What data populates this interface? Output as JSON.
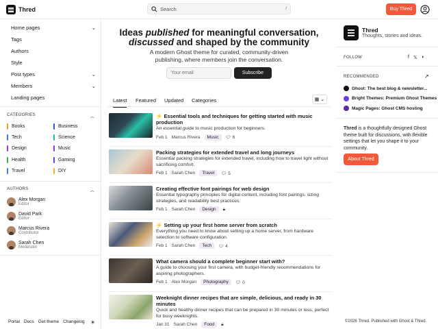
{
  "header": {
    "logo_text": "Thred",
    "search_placeholder": "Search",
    "search_shortcut": "/",
    "buy_label": "Buy Thred"
  },
  "sidebar": {
    "nav": [
      {
        "label": "Home pages",
        "expand": true
      },
      {
        "label": "Tags",
        "expand": false
      },
      {
        "label": "Authors",
        "expand": false
      },
      {
        "label": "Style",
        "expand": false
      },
      {
        "label": "Post types",
        "expand": true
      },
      {
        "label": "Members",
        "expand": true
      },
      {
        "label": "Landing pages",
        "expand": false
      }
    ],
    "categories_title": "CATEGORIES",
    "categories": [
      {
        "label": "Books",
        "color": "#f29b2b"
      },
      {
        "label": "Business",
        "color": "#3d4fd1"
      },
      {
        "label": "Tech",
        "color": "#3c7be0"
      },
      {
        "label": "Science",
        "color": "#27b3a5"
      },
      {
        "label": "Design",
        "color": "#9b3fd9"
      },
      {
        "label": "Music",
        "color": "#8a3fe0"
      },
      {
        "label": "Health",
        "color": "#2fb34a"
      },
      {
        "label": "Gaming",
        "color": "#6b3fe0"
      },
      {
        "label": "Travel",
        "color": "#3e7fe6"
      },
      {
        "label": "DIY",
        "color": "#e8b52b"
      }
    ],
    "authors_title": "AUTHORS",
    "authors": [
      {
        "name": "Alex Morgan",
        "role": "Editor"
      },
      {
        "name": "David Park",
        "role": "Editor"
      },
      {
        "name": "Marcus Rivera",
        "role": "Contributor"
      },
      {
        "name": "Sarah Chen",
        "role": "Moderator"
      }
    ],
    "footer_links": [
      "Portal",
      "Docs",
      "Get theme",
      "Changelog"
    ]
  },
  "hero": {
    "title_1": "Ideas ",
    "title_em1": "published",
    "title_2": " for meaningful conversation,",
    "title_em2": "discussed",
    "title_3": " and shaped by the community",
    "subtitle": "A modern Ghost theme for curated, community-driven publishing, where members join the conversation.",
    "email_placeholder": "Your email",
    "subscribe_label": "Subscribe"
  },
  "tabs": [
    "Latest",
    "Featured",
    "Updated",
    "Categories"
  ],
  "posts": [
    {
      "title": "Essential tools and techniques for getting started with music production",
      "featured": true,
      "excerpt": "An essential guide to music production for beginners.",
      "date": "Feb 1",
      "author": "Marcus Rivera",
      "tag": "Music",
      "comments": "6",
      "locked": false
    },
    {
      "title": "Packing strategies for extended travel and long journeys",
      "featured": false,
      "excerpt": "Essential packing strategies for extended travel, including how to travel light without sacrificing comfort.",
      "date": "Feb 1",
      "author": "Sarah Chen",
      "tag": "Travel",
      "comments": "5",
      "locked": false
    },
    {
      "title": "Creating effective font pairings for web design",
      "featured": false,
      "excerpt": "Essential typography principles for digital content, including font pairings, sizing strategies, and readability best practices.",
      "date": "Feb 1",
      "author": "Sarah Chen",
      "tag": "Design",
      "comments": "",
      "locked": true
    },
    {
      "title": "Setting up your first home server from scratch",
      "featured": true,
      "excerpt": "Everything you need to know about setting up a home server, from hardware selection to software configuration.",
      "date": "Feb 1",
      "author": "Sarah Chen",
      "tag": "Tech",
      "comments": "4",
      "locked": false
    },
    {
      "title": "What camera should a complete beginner start with?",
      "featured": false,
      "excerpt": "A guide to choosing your first camera, with budget-friendly recommendations for aspiring photographers.",
      "date": "Feb 1",
      "author": "Alex Morgan",
      "tag": "Photography",
      "comments": "0",
      "locked": false
    },
    {
      "title": "Weeknight dinner recipes that are simple, delicious, and ready in 30 minutes",
      "featured": false,
      "excerpt": "Quick and healthy dinner recipes that can be prepared in 30 minutes or less, perfect for busy weeknights.",
      "date": "Jan 31",
      "author": "Sarah Chen",
      "tag": "Food",
      "comments": "",
      "locked": true
    }
  ],
  "right": {
    "title": "Thred",
    "subtitle": "Thoughts, stories and ideas.",
    "follow_label": "FOLLOW",
    "recommended_label": "RECOMMENDED",
    "recommended": [
      {
        "label": "Ghost: The best blog & newsletter...",
        "color": "#111"
      },
      {
        "label": "Bright Themes: Premium Ghost Themes",
        "color": "#6b3fe0"
      },
      {
        "label": "Magic Pages: Ghost CMS hosting",
        "color": "#5a2ea6"
      }
    ],
    "about_name": "Thred",
    "about_text": " is a thoughtfully designed Ghost theme built for discussions, with flexible settings that let you shape it to your community.",
    "about_button": "About Thred",
    "copyright": "©2026 Thred. Published with Ghost & Thred."
  }
}
